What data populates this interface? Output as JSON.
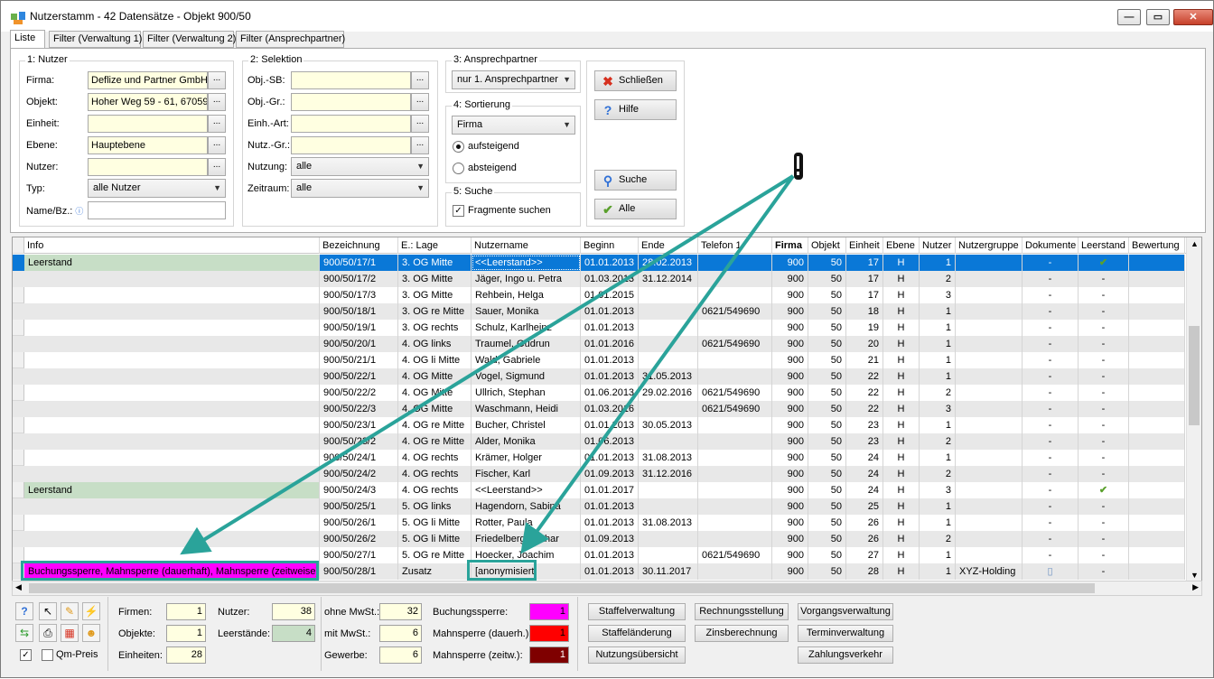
{
  "window": {
    "title": "Nutzerstamm - 42 Datensätze - Objekt 900/50"
  },
  "tabs": [
    "Liste",
    "Filter (Verwaltung 1)",
    "Filter (Verwaltung 2)",
    "Filter (Ansprechpartner)"
  ],
  "nutzer_group": {
    "title": "1: Nutzer",
    "firma_label": "Firma:",
    "firma_value": "Deflize und Partner GmbH",
    "objekt_label": "Objekt:",
    "objekt_value": "Hoher Weg 59 - 61, 67059",
    "einheit_label": "Einheit:",
    "einheit_value": "",
    "ebene_label": "Ebene:",
    "ebene_value": "Hauptebene",
    "nutzer_label": "Nutzer:",
    "nutzer_value": "",
    "typ_label": "Typ:",
    "typ_value": "alle Nutzer",
    "namebz_label": "Name/Bz.:",
    "namebz_value": ""
  },
  "selektion_group": {
    "title": "2: Selektion",
    "objsb_label": "Obj.-SB:",
    "objgr_label": "Obj.-Gr.:",
    "einhart_label": "Einh.-Art:",
    "nutzgr_label": "Nutz.-Gr.:",
    "nutzung_label": "Nutzung:",
    "nutzung_value": "alle",
    "zeitraum_label": "Zeitraum:",
    "zeitraum_value": "alle"
  },
  "ansprech_group": {
    "title": "3: Ansprechpartner",
    "value": "nur 1. Ansprechpartner"
  },
  "sort_group": {
    "title": "4: Sortierung",
    "value": "Firma",
    "asc": "aufsteigend",
    "desc": "absteigend"
  },
  "suche_group": {
    "title": "5: Suche",
    "fragment": "Fragmente suchen"
  },
  "buttons": {
    "schliessen": "Schließen",
    "hilfe": "Hilfe",
    "suche": "Suche",
    "alle": "Alle"
  },
  "columns": [
    "Info",
    "Bezeichnung",
    "E.: Lage",
    "Nutzername",
    "Beginn",
    "Ende",
    "Telefon 1",
    "Firma",
    "Objekt",
    "Einheit",
    "Ebene",
    "Nutzer",
    "Nutzergruppe",
    "Dokumente",
    "Leerstand",
    "Bewertung"
  ],
  "rows": [
    {
      "info": "Leerstand",
      "info_style": "green",
      "bez": "900/50/17/1",
      "lage": "3. OG Mitte",
      "name": "<<Leerstand>>",
      "beginn": "01.01.2013",
      "ende": "28.02.2013",
      "tel": "",
      "firma": "900",
      "objekt": "50",
      "einheit": "17",
      "ebene": "H",
      "nutzer": "1",
      "gruppe": "",
      "dok": "-",
      "leer": "check",
      "sel": true
    },
    {
      "info": "",
      "bez": "900/50/17/2",
      "lage": "3. OG Mitte",
      "name": "Jäger, Ingo u. Petra",
      "beginn": "01.03.2013",
      "ende": "31.12.2014",
      "tel": "",
      "firma": "900",
      "objekt": "50",
      "einheit": "17",
      "ebene": "H",
      "nutzer": "2",
      "gruppe": "",
      "dok": "-",
      "leer": "-"
    },
    {
      "info": "",
      "bez": "900/50/17/3",
      "lage": "3. OG Mitte",
      "name": "Rehbein, Helga",
      "beginn": "01.01.2015",
      "ende": "",
      "tel": "",
      "firma": "900",
      "objekt": "50",
      "einheit": "17",
      "ebene": "H",
      "nutzer": "3",
      "gruppe": "",
      "dok": "-",
      "leer": "-"
    },
    {
      "info": "",
      "bez": "900/50/18/1",
      "lage": "3. OG re Mitte",
      "name": "Sauer, Monika",
      "beginn": "01.01.2013",
      "ende": "",
      "tel": "0621/549690",
      "firma": "900",
      "objekt": "50",
      "einheit": "18",
      "ebene": "H",
      "nutzer": "1",
      "gruppe": "",
      "dok": "-",
      "leer": "-"
    },
    {
      "info": "",
      "bez": "900/50/19/1",
      "lage": "3. OG rechts",
      "name": "Schulz, Karlheinz",
      "beginn": "01.01.2013",
      "ende": "",
      "tel": "",
      "firma": "900",
      "objekt": "50",
      "einheit": "19",
      "ebene": "H",
      "nutzer": "1",
      "gruppe": "",
      "dok": "-",
      "leer": "-"
    },
    {
      "info": "",
      "bez": "900/50/20/1",
      "lage": "4. OG links",
      "name": "Traumel, Gudrun",
      "beginn": "01.01.2016",
      "ende": "",
      "tel": "0621/549690",
      "firma": "900",
      "objekt": "50",
      "einheit": "20",
      "ebene": "H",
      "nutzer": "1",
      "gruppe": "",
      "dok": "-",
      "leer": "-"
    },
    {
      "info": "",
      "bez": "900/50/21/1",
      "lage": "4. OG li Mitte",
      "name": "Wald, Gabriele",
      "beginn": "01.01.2013",
      "ende": "",
      "tel": "",
      "firma": "900",
      "objekt": "50",
      "einheit": "21",
      "ebene": "H",
      "nutzer": "1",
      "gruppe": "",
      "dok": "-",
      "leer": "-"
    },
    {
      "info": "",
      "bez": "900/50/22/1",
      "lage": "4. OG Mitte",
      "name": "Vogel, Sigmund",
      "beginn": "01.01.2013",
      "ende": "31.05.2013",
      "tel": "",
      "firma": "900",
      "objekt": "50",
      "einheit": "22",
      "ebene": "H",
      "nutzer": "1",
      "gruppe": "",
      "dok": "-",
      "leer": "-"
    },
    {
      "info": "",
      "bez": "900/50/22/2",
      "lage": "4. OG Mitte",
      "name": "Ullrich, Stephan",
      "beginn": "01.06.2013",
      "ende": "29.02.2016",
      "tel": "0621/549690",
      "firma": "900",
      "objekt": "50",
      "einheit": "22",
      "ebene": "H",
      "nutzer": "2",
      "gruppe": "",
      "dok": "-",
      "leer": "-"
    },
    {
      "info": "",
      "bez": "900/50/22/3",
      "lage": "4. OG Mitte",
      "name": "Waschmann, Heidi",
      "beginn": "01.03.2016",
      "ende": "",
      "tel": "0621/549690",
      "firma": "900",
      "objekt": "50",
      "einheit": "22",
      "ebene": "H",
      "nutzer": "3",
      "gruppe": "",
      "dok": "-",
      "leer": "-"
    },
    {
      "info": "",
      "bez": "900/50/23/1",
      "lage": "4. OG re Mitte",
      "name": "Bucher, Christel",
      "beginn": "01.01.2013",
      "ende": "30.05.2013",
      "tel": "",
      "firma": "900",
      "objekt": "50",
      "einheit": "23",
      "ebene": "H",
      "nutzer": "1",
      "gruppe": "",
      "dok": "-",
      "leer": "-"
    },
    {
      "info": "",
      "bez": "900/50/23/2",
      "lage": "4. OG re Mitte",
      "name": "Alder, Monika",
      "beginn": "01.06.2013",
      "ende": "",
      "tel": "",
      "firma": "900",
      "objekt": "50",
      "einheit": "23",
      "ebene": "H",
      "nutzer": "2",
      "gruppe": "",
      "dok": "-",
      "leer": "-"
    },
    {
      "info": "",
      "bez": "900/50/24/1",
      "lage": "4. OG rechts",
      "name": "Krämer, Holger",
      "beginn": "01.01.2013",
      "ende": "31.08.2013",
      "tel": "",
      "firma": "900",
      "objekt": "50",
      "einheit": "24",
      "ebene": "H",
      "nutzer": "1",
      "gruppe": "",
      "dok": "-",
      "leer": "-"
    },
    {
      "info": "",
      "bez": "900/50/24/2",
      "lage": "4. OG rechts",
      "name": "Fischer, Karl",
      "beginn": "01.09.2013",
      "ende": "31.12.2016",
      "tel": "",
      "firma": "900",
      "objekt": "50",
      "einheit": "24",
      "ebene": "H",
      "nutzer": "2",
      "gruppe": "",
      "dok": "-",
      "leer": "-"
    },
    {
      "info": "Leerstand",
      "info_style": "green",
      "bez": "900/50/24/3",
      "lage": "4. OG rechts",
      "name": "<<Leerstand>>",
      "beginn": "01.01.2017",
      "ende": "",
      "tel": "",
      "firma": "900",
      "objekt": "50",
      "einheit": "24",
      "ebene": "H",
      "nutzer": "3",
      "gruppe": "",
      "dok": "-",
      "leer": "check"
    },
    {
      "info": "",
      "bez": "900/50/25/1",
      "lage": "5. OG links",
      "name": "Hagendorn, Sabina",
      "beginn": "01.01.2013",
      "ende": "",
      "tel": "",
      "firma": "900",
      "objekt": "50",
      "einheit": "25",
      "ebene": "H",
      "nutzer": "1",
      "gruppe": "",
      "dok": "-",
      "leer": "-"
    },
    {
      "info": "",
      "bez": "900/50/26/1",
      "lage": "5. OG li Mitte",
      "name": "Rotter, Paula",
      "beginn": "01.01.2013",
      "ende": "31.08.2013",
      "tel": "",
      "firma": "900",
      "objekt": "50",
      "einheit": "26",
      "ebene": "H",
      "nutzer": "1",
      "gruppe": "",
      "dok": "-",
      "leer": "-"
    },
    {
      "info": "",
      "bez": "900/50/26/2",
      "lage": "5. OG li Mitte",
      "name": "Friedelberg, Lothar",
      "beginn": "01.09.2013",
      "ende": "",
      "tel": "",
      "firma": "900",
      "objekt": "50",
      "einheit": "26",
      "ebene": "H",
      "nutzer": "2",
      "gruppe": "",
      "dok": "-",
      "leer": "-"
    },
    {
      "info": "",
      "bez": "900/50/27/1",
      "lage": "5. OG re Mitte",
      "name": "Hoecker, Joachim",
      "beginn": "01.01.2013",
      "ende": "",
      "tel": "0621/549690",
      "firma": "900",
      "objekt": "50",
      "einheit": "27",
      "ebene": "H",
      "nutzer": "1",
      "gruppe": "",
      "dok": "-",
      "leer": "-"
    },
    {
      "info": "Buchungssperre, Mahnsperre (dauerhaft), Mahnsperre (zeitweise)",
      "info_style": "pink",
      "bez": "900/50/28/1",
      "lage": "Zusatz",
      "name": "[anonymisiert]",
      "beginn": "01.01.2013",
      "ende": "30.11.2017",
      "tel": "",
      "firma": "900",
      "objekt": "50",
      "einheit": "28",
      "ebene": "H",
      "nutzer": "1",
      "gruppe": "XYZ-Holding",
      "dok": "doc",
      "leer": "-"
    }
  ],
  "summary": {
    "firmen_label": "Firmen:",
    "firmen": "1",
    "objekte_label": "Objekte:",
    "objekte": "1",
    "einheiten_label": "Einheiten:",
    "einheiten": "28",
    "nutzer_label": "Nutzer:",
    "nutzer": "38",
    "leerstaende_label": "Leerstände:",
    "leerstaende": "4",
    "ohne_label": "ohne MwSt.:",
    "ohne": "32",
    "mit_label": "mit MwSt.:",
    "mit": "6",
    "gewerbe_label": "Gewerbe:",
    "gewerbe": "6",
    "buchung_label": "Buchungssperre:",
    "buchung": "1",
    "mahn_d_label": "Mahnsperre (dauerh.):",
    "mahn_d": "1",
    "mahn_z_label": "Mahnsperre (zeitw.):",
    "mahn_z": "1",
    "qm_label": "Qm-Preis"
  },
  "actions": [
    "Staffelverwaltung",
    "Rechnungsstellung",
    "Vorgangsverwaltung",
    "Staffeländerung",
    "Zinsberechnung",
    "Terminverwaltung",
    "Nutzungsübersicht",
    "Zahlungsverkehr"
  ],
  "colors": {
    "selection": "#0a78d7",
    "leerstand": "#c7dec6",
    "buchungssperre": "#ff00ff",
    "mahn_dauerhaft": "#ff0000",
    "mahn_zeitweise": "#7f0000",
    "annotation": "#2aa39a"
  }
}
